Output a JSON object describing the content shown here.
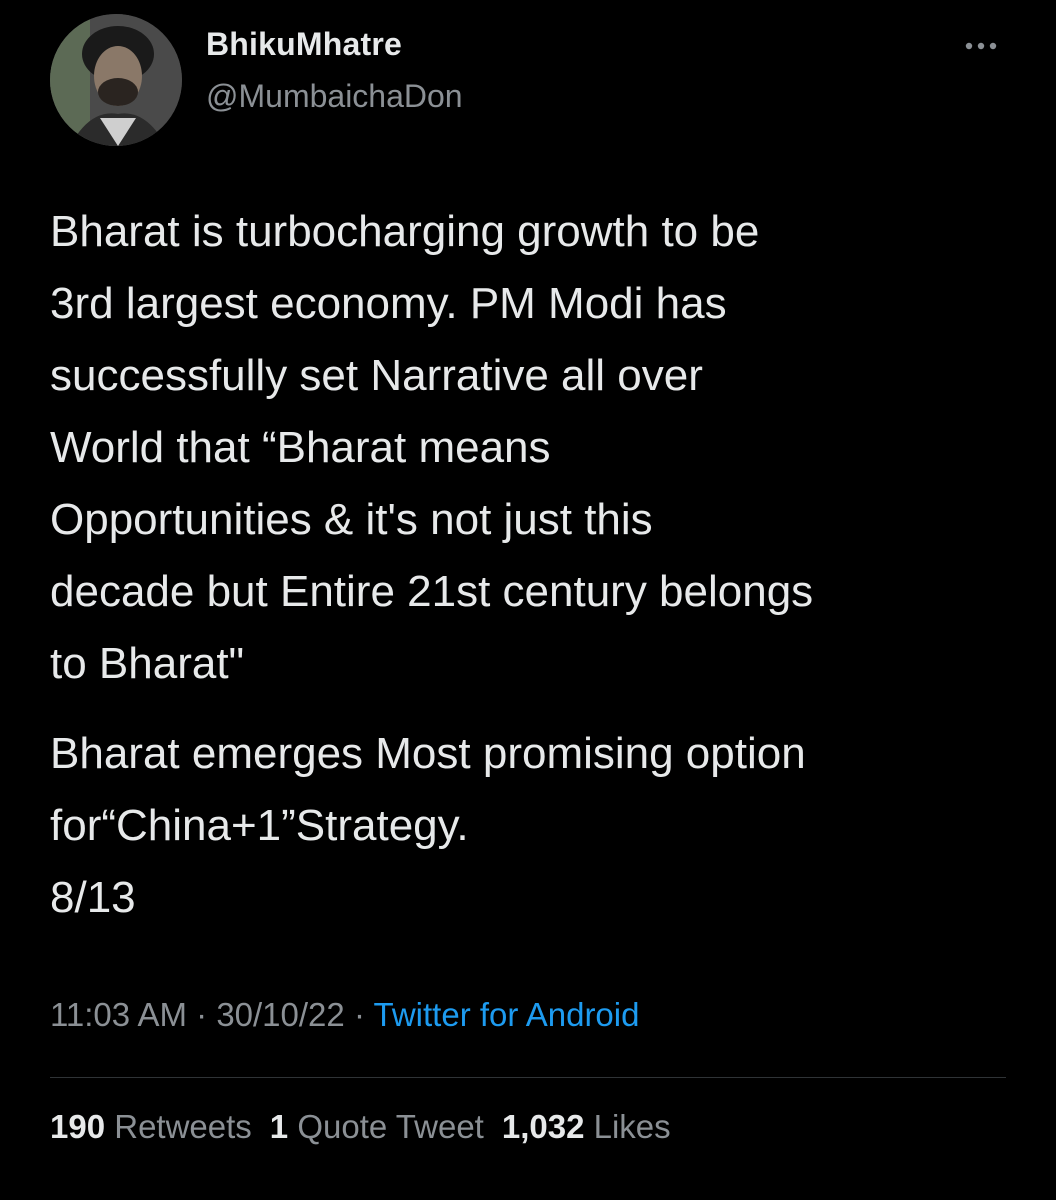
{
  "author": {
    "display_name": "BhikuMhatre",
    "handle": "@MumbaichaDon"
  },
  "tweet": {
    "paragraph_1": "Bharat is turbocharging growth to be\n3rd largest economy. PM Modi has\nsuccessfully set Narrative all over\nWorld that “Bharat means\nOpportunities & it's not just this\ndecade but Entire 21st century belongs\nto Bharat\"",
    "paragraph_2": "Bharat emerges Most promising option\nfor“China+1”Strategy.\n8/13",
    "time": "11:03 AM",
    "separator_1": " · ",
    "date": "30/10/22",
    "separator_2": " · ",
    "source": "Twitter for Android"
  },
  "stats": {
    "retweets_count": "190",
    "retweets_label": "Retweets",
    "quotes_count": "1",
    "quotes_label": "Quote Tweet",
    "likes_count": "1,032",
    "likes_label": "Likes"
  },
  "icons": {
    "more": "more-horizontal-icon"
  },
  "colors": {
    "background": "#000000",
    "primary_text": "#e7e9ea",
    "secondary_text": "#8b9095",
    "link": "#1d9bf0",
    "divider": "#2f3336"
  }
}
